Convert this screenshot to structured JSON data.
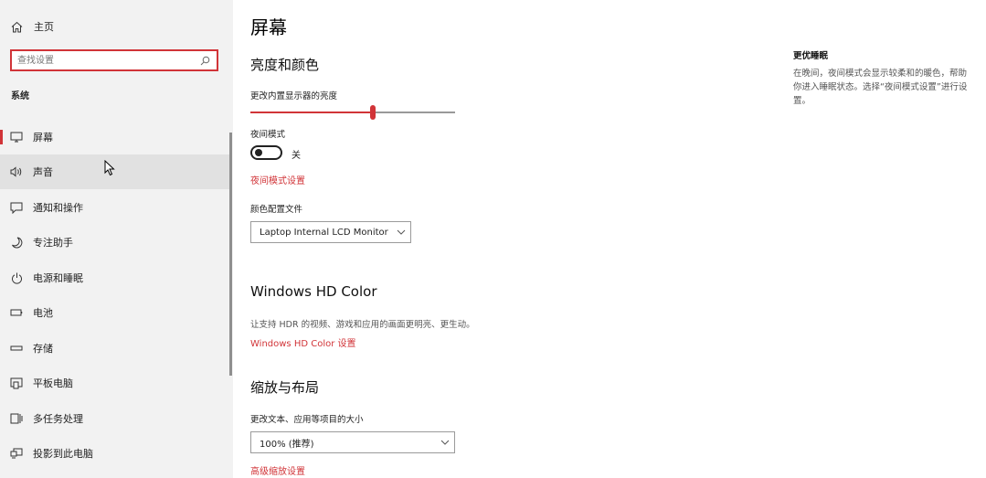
{
  "sidebar": {
    "home_label": "主页",
    "search_placeholder": "查找设置",
    "section_label": "系统",
    "items": [
      {
        "label": "屏幕",
        "icon": "monitor-icon"
      },
      {
        "label": "声音",
        "icon": "speaker-icon"
      },
      {
        "label": "通知和操作",
        "icon": "notification-icon"
      },
      {
        "label": "专注助手",
        "icon": "moon-icon"
      },
      {
        "label": "电源和睡眠",
        "icon": "power-icon"
      },
      {
        "label": "电池",
        "icon": "battery-icon"
      },
      {
        "label": "存储",
        "icon": "storage-icon"
      },
      {
        "label": "平板电脑",
        "icon": "tablet-icon"
      },
      {
        "label": "多任务处理",
        "icon": "multitask-icon"
      },
      {
        "label": "投影到此电脑",
        "icon": "project-icon"
      }
    ]
  },
  "main": {
    "page_title": "屏幕",
    "brightness": {
      "heading": "亮度和颜色",
      "slider_label": "更改内置显示器的亮度",
      "slider_value": 0.6
    },
    "night_light": {
      "label": "夜间模式",
      "state": "关",
      "settings_link": "夜间模式设置"
    },
    "color_profile": {
      "label": "颜色配置文件",
      "value": "Laptop Internal LCD Monitor"
    },
    "hdr": {
      "heading": "Windows HD Color",
      "description": "让支持 HDR 的视频、游戏和应用的画面更明亮、更生动。",
      "link": "Windows HD Color 设置"
    },
    "scale": {
      "heading": "缩放与布局",
      "label": "更改文本、应用等项目的大小",
      "value": "100% (推荐)",
      "advanced_link": "高级缩放设置"
    }
  },
  "right_panel": {
    "title": "更优睡眠",
    "text": "在晚间，夜间模式会显示较柔和的暖色，帮助你进入睡眠状态。选择“夜间模式设置”进行设置。"
  }
}
